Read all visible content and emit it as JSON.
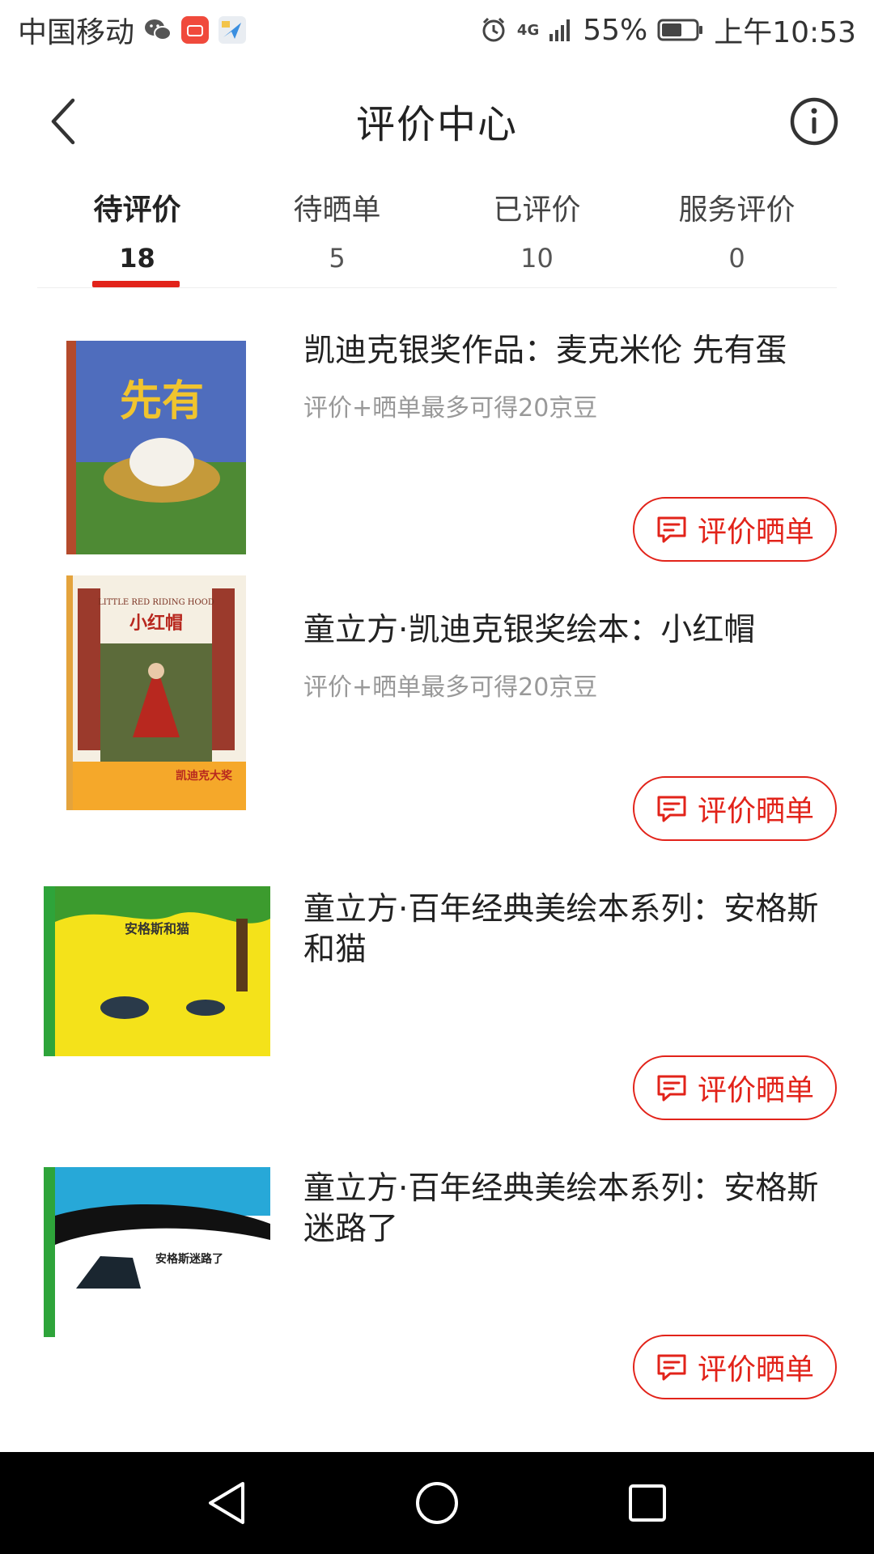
{
  "status_bar": {
    "carrier": "中国移动",
    "network": "4G",
    "battery": "55%",
    "time": "上午10:53",
    "left_icons": [
      "wechat-icon",
      "jd-app-icon",
      "map-app-icon"
    ],
    "right_icons": [
      "alarm-icon",
      "signal-icon",
      "battery-icon"
    ]
  },
  "header": {
    "title": "评价中心",
    "back_icon": "chevron-left-icon",
    "info_icon": "info-icon"
  },
  "tabs": [
    {
      "label": "待评价",
      "count": "18",
      "active": true
    },
    {
      "label": "待晒单",
      "count": "5",
      "active": false
    },
    {
      "label": "已评价",
      "count": "10",
      "active": false
    },
    {
      "label": "服务评价",
      "count": "0",
      "active": false
    }
  ],
  "products": [
    {
      "title": "凯迪克银奖作品：麦克米伦 先有蛋",
      "hint": "评价+晒单最多可得20京豆",
      "button": "评价晒单",
      "cover_text": "先有"
    },
    {
      "title": "童立方·凯迪克银奖绘本：小红帽",
      "hint": "评价+晒单最多可得20京豆",
      "button": "评价晒单",
      "cover_text": "小红帽",
      "cover_subtext": "LITTLE RED RIDING HOOD",
      "cover_banner": "凯迪克大奖"
    },
    {
      "title": "童立方·百年经典美绘本系列：安格斯和猫",
      "hint": "",
      "button": "评价晒单",
      "cover_text": "安格斯和猫"
    },
    {
      "title": "童立方·百年经典美绘本系列：安格斯迷路了",
      "hint": "",
      "button": "评价晒单",
      "cover_text": "安格斯迷路了"
    }
  ],
  "colors": {
    "accent": "#e2231a",
    "hint": "#999999",
    "nav_bar": "#000000"
  }
}
